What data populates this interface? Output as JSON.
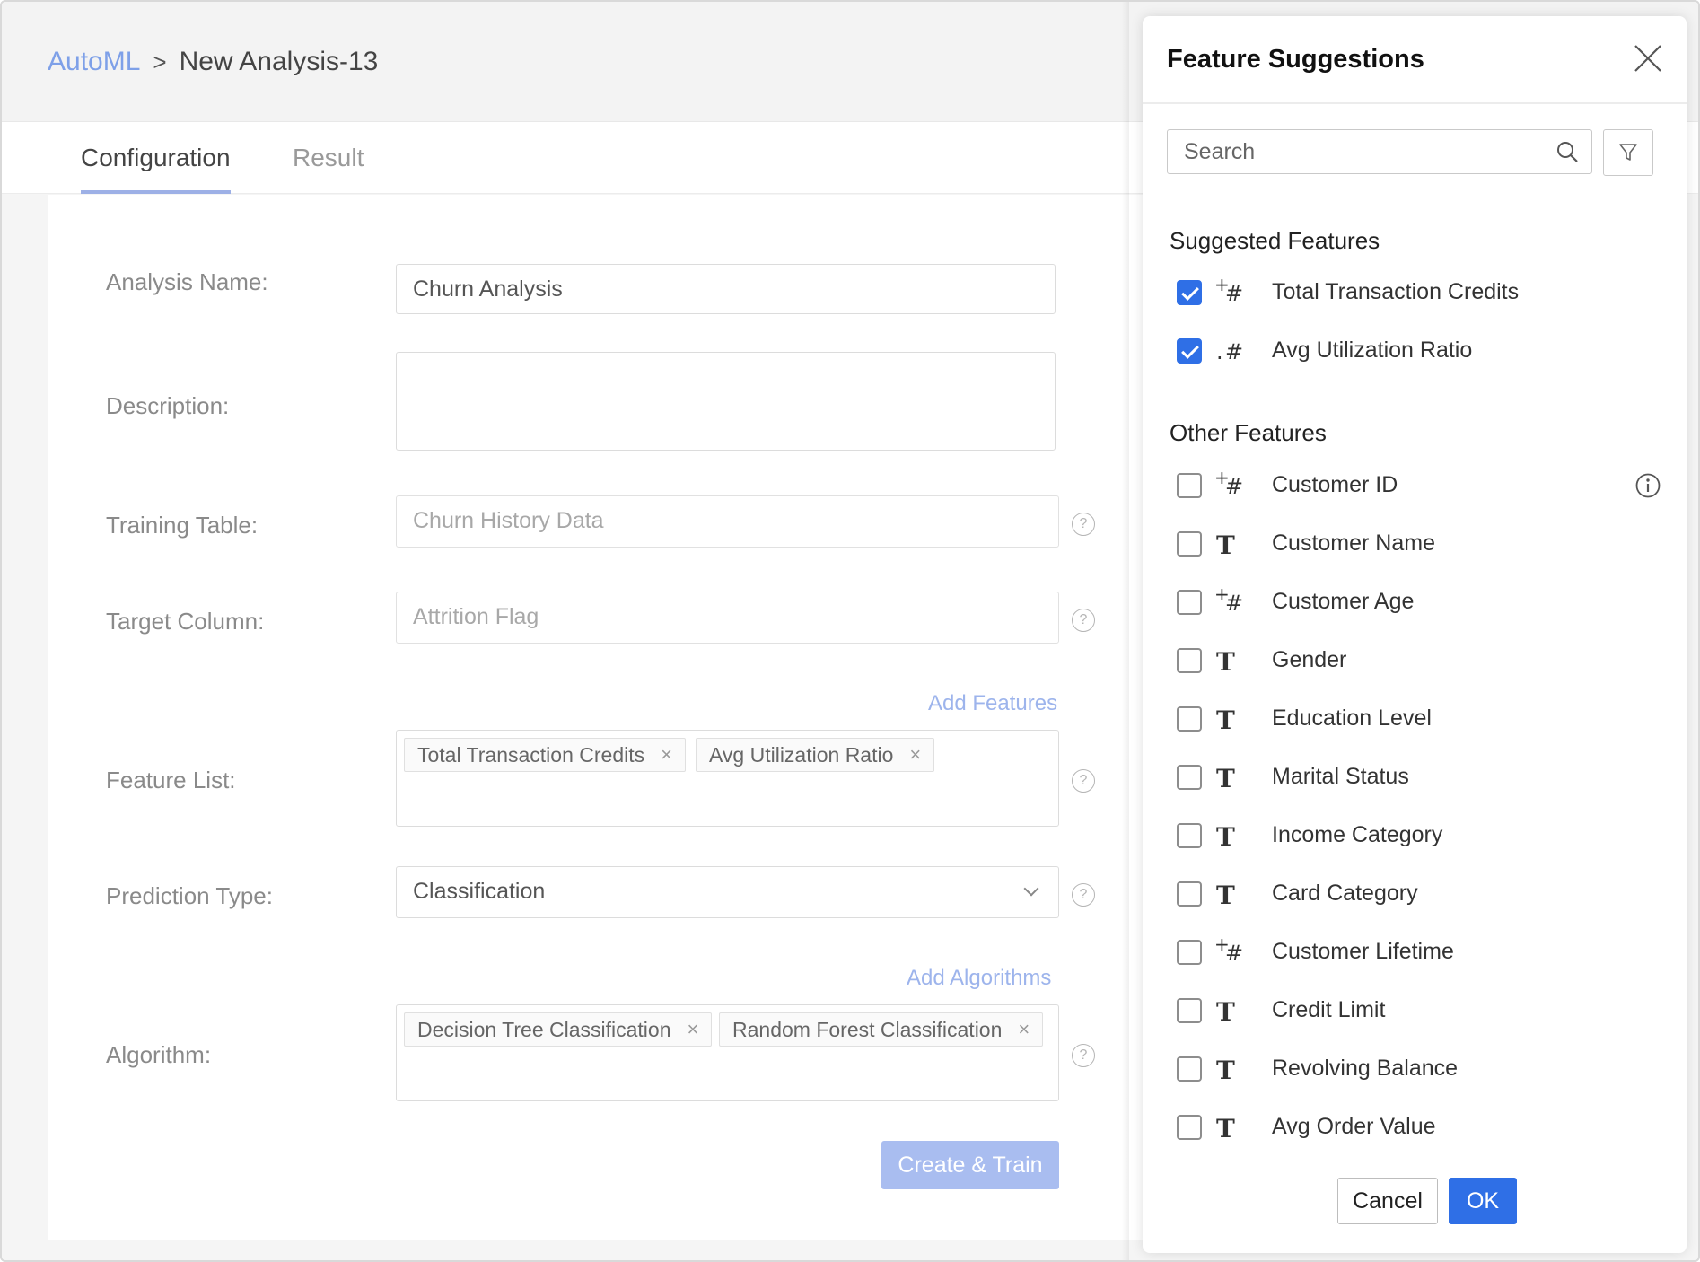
{
  "breadcrumb": {
    "root": "AutoML",
    "separator": ">",
    "current": "New Analysis-13"
  },
  "tabs": [
    {
      "label": "Configuration",
      "active": true
    },
    {
      "label": "Result",
      "active": false
    }
  ],
  "form": {
    "analysis_name": {
      "label": "Analysis Name:",
      "value": "Churn Analysis"
    },
    "description": {
      "label": "Description:",
      "value": ""
    },
    "training_table": {
      "label": "Training Table:",
      "value": "Churn History Data"
    },
    "target_column": {
      "label": "Target Column:",
      "value": "Attrition Flag"
    },
    "add_features_link": "Add Features",
    "feature_list": {
      "label": "Feature List:",
      "chips": [
        "Total Transaction Credits",
        "Avg Utilization Ratio"
      ]
    },
    "prediction_type": {
      "label": "Prediction Type:",
      "value": "Classification"
    },
    "add_algorithms_link": "Add Algorithms",
    "algorithm": {
      "label": "Algorithm:",
      "chips": [
        "Decision Tree Classification",
        "Random Forest Classification"
      ]
    },
    "help_glyph": "?",
    "chip_remove_glyph": "×",
    "create_button": "Create & Train"
  },
  "panel": {
    "title": "Feature Suggestions",
    "search_placeholder": "Search",
    "suggested_title": "Suggested Features",
    "suggested": [
      {
        "type": "numeric-plus",
        "name": "Total Transaction Credits",
        "checked": true
      },
      {
        "type": "numeric-dot",
        "name": "Avg Utilization Ratio",
        "checked": true
      }
    ],
    "other_title": "Other Features",
    "other": [
      {
        "type": "numeric-plus",
        "name": "Customer ID",
        "checked": false,
        "info": true
      },
      {
        "type": "text",
        "name": "Customer Name",
        "checked": false
      },
      {
        "type": "numeric-plus",
        "name": "Customer Age",
        "checked": false
      },
      {
        "type": "text",
        "name": "Gender",
        "checked": false
      },
      {
        "type": "text",
        "name": "Education Level",
        "checked": false
      },
      {
        "type": "text",
        "name": "Marital Status",
        "checked": false
      },
      {
        "type": "text",
        "name": "Income Category",
        "checked": false
      },
      {
        "type": "text",
        "name": "Card Category",
        "checked": false
      },
      {
        "type": "numeric-plus",
        "name": "Customer Lifetime",
        "checked": false
      },
      {
        "type": "text",
        "name": "Credit Limit",
        "checked": false
      },
      {
        "type": "text",
        "name": "Revolving Balance",
        "checked": false
      },
      {
        "type": "text",
        "name": "Avg Order Value",
        "checked": false
      }
    ],
    "type_glyphs": {
      "text": "T",
      "plus": "+",
      "hash": "#",
      "dot": "."
    },
    "cancel_label": "Cancel",
    "ok_label": "OK"
  },
  "colors": {
    "accent": "#2f6fe6",
    "link": "#7ea0e8",
    "primary_disabled": "#a9bdf0"
  }
}
